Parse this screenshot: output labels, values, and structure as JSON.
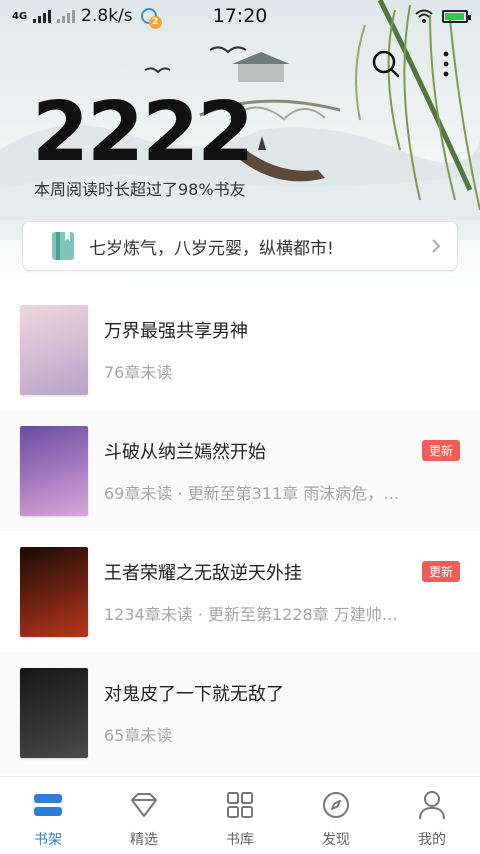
{
  "status_bar": {
    "network_type": "4G",
    "speed": "2.8k/s",
    "notification_count": "2",
    "time": "17:20",
    "battery_level": 0.95
  },
  "hero": {
    "reading_count": "2222",
    "reading_desc": "本周阅读时长超过了98%书友"
  },
  "promo": {
    "text": "七岁炼气，八岁元婴，纵横都市!"
  },
  "books": [
    {
      "title": "万界最强共享男神",
      "sub": "76章未读",
      "badge": "",
      "cover_colors": [
        "#f1d6dc",
        "#b8a3c9"
      ]
    },
    {
      "title": "斗破从纳兰嫣然开始",
      "sub": "69章未读 · 更新至第311章 雨沫病危，…",
      "badge": "更新",
      "cover_colors": [
        "#6b4aa3",
        "#d9a6d8"
      ]
    },
    {
      "title": "王者荣耀之无敌逆天外挂",
      "sub": "1234章未读 · 更新至第1228章 万建帅…",
      "badge": "更新",
      "cover_colors": [
        "#1a0c05",
        "#b8361c"
      ]
    },
    {
      "title": "对鬼皮了一下就无敌了",
      "sub": "65章未读",
      "badge": "",
      "cover_colors": [
        "#161616",
        "#4a4a4a"
      ]
    }
  ],
  "nav": [
    {
      "label": "书架",
      "icon": "bookshelf-icon",
      "active": true
    },
    {
      "label": "精选",
      "icon": "diamond-icon",
      "active": false
    },
    {
      "label": "书库",
      "icon": "grid-icon",
      "active": false
    },
    {
      "label": "发现",
      "icon": "compass-icon",
      "active": false
    },
    {
      "label": "我的",
      "icon": "user-icon",
      "active": false
    }
  ],
  "colors": {
    "accent": "#2b7fd8",
    "badge": "#ee5d57",
    "muted_text": "#a6a6a6"
  }
}
